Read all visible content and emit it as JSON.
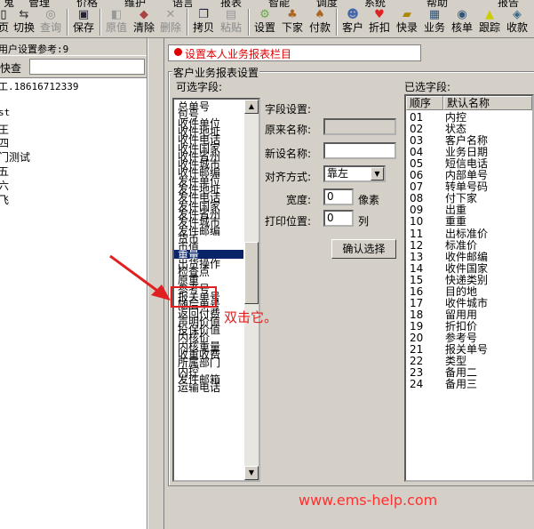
{
  "menubar": [
    "鬼",
    "管理",
    "价格",
    "维护",
    "语言",
    "报表",
    "智能",
    "调度",
    "系统",
    "帮助",
    "报告"
  ],
  "toolbar": {
    "buttons": [
      {
        "label": "页",
        "icon": "page-icon"
      },
      {
        "label": "切换",
        "icon": "switch-icon"
      },
      {
        "label": "查询",
        "icon": "binoculars-icon",
        "disabled": true
      },
      {
        "label": "保存",
        "icon": "floppy-disk-icon"
      },
      {
        "label": "原值",
        "icon": "revert-icon",
        "disabled": true
      },
      {
        "label": "清除",
        "icon": "eraser-icon"
      },
      {
        "label": "删除",
        "icon": "delete-x-icon",
        "disabled": true
      },
      {
        "label": "拷贝",
        "icon": "copy-icon"
      },
      {
        "label": "粘贴",
        "icon": "paste-icon",
        "disabled": true
      },
      {
        "label": "设置",
        "icon": "settings-icon"
      },
      {
        "label": "下家",
        "icon": "next-party-icon"
      },
      {
        "label": "付款",
        "icon": "payment-icon"
      },
      {
        "label": "客户",
        "icon": "customers-icon"
      },
      {
        "label": "折扣",
        "icon": "discount-heart-icon"
      },
      {
        "label": "快录",
        "icon": "quick-entry-icon"
      },
      {
        "label": "业务",
        "icon": "business-icon"
      },
      {
        "label": "核单",
        "icon": "check-order-icon"
      },
      {
        "label": "跟踪",
        "icon": "tracking-icon"
      },
      {
        "label": "收款",
        "icon": "receipt-icon"
      }
    ]
  },
  "left": {
    "header": "用户设置参考:9",
    "search_label": "快查",
    "search_value": "",
    "tree_items": [
      "工.18616712339",
      "",
      "st",
      "王",
      "四",
      "门测试",
      "五",
      "六",
      "飞"
    ]
  },
  "banner": "设置本人业务报表栏目",
  "group_title": "客户业务报表设置",
  "available": {
    "label": "可选字段:",
    "items": [
      "总单号",
      "包号",
      "收件单位",
      "收件地址",
      "收件电话",
      "收件国家",
      "收件省州",
      "收件城市",
      "收件邮编",
      "发件单位",
      "发件地址",
      "发件电话",
      "发件国家",
      "发件省州",
      "发件城市",
      "发件邮编",
      "货币",
      "币值",
      "重量",
      "出货操作",
      "检查点",
      "原重",
      "参考号",
      "报关单号",
      "随后单号",
      "返回付费",
      "声明价值",
      "投保价值",
      "内核价",
      "内核重量",
      "收重收费",
      "所属部门",
      "内控",
      "发件邮箱",
      "运输电话"
    ],
    "selected_item": "重量"
  },
  "field_settings": {
    "title": "字段设置:",
    "orig_name_label": "原来名称:",
    "orig_name_value": "",
    "new_name_label": "新设名称:",
    "new_name_value": "",
    "align_label": "对齐方式:",
    "align_value": "靠左",
    "width_label": "宽度:",
    "width_value": "0",
    "width_unit": "像素",
    "print_pos_label": "打印位置:",
    "print_pos_value": "0",
    "print_pos_unit": "列",
    "confirm_button": "确认选择"
  },
  "selected": {
    "label": "已选字段:",
    "columns": [
      "顺序",
      "默认名称"
    ],
    "rows": [
      [
        "01",
        "内控"
      ],
      [
        "02",
        "状态"
      ],
      [
        "03",
        "客户名称"
      ],
      [
        "04",
        "业务日期"
      ],
      [
        "05",
        "短信电话"
      ],
      [
        "06",
        "内部单号"
      ],
      [
        "07",
        "转单号码"
      ],
      [
        "08",
        "付下家"
      ],
      [
        "09",
        "出重"
      ],
      [
        "10",
        "重重"
      ],
      [
        "11",
        "出标准价"
      ],
      [
        "12",
        "标准价"
      ],
      [
        "13",
        "收件邮编"
      ],
      [
        "14",
        "收件国家"
      ],
      [
        "15",
        "快递类别"
      ],
      [
        "16",
        "目的地"
      ],
      [
        "17",
        "收件城市"
      ],
      [
        "18",
        "留用用"
      ],
      [
        "19",
        "折扣价"
      ],
      [
        "20",
        "参考号"
      ],
      [
        "21",
        "报关单号"
      ],
      [
        "22",
        "类型"
      ],
      [
        "23",
        "备用二"
      ],
      [
        "24",
        "备用三"
      ]
    ]
  },
  "annotation": {
    "text": "双击它。"
  },
  "watermark": "www.ems-help.com",
  "colors": {
    "accent": "#e02020",
    "selection": "#0a246a"
  }
}
